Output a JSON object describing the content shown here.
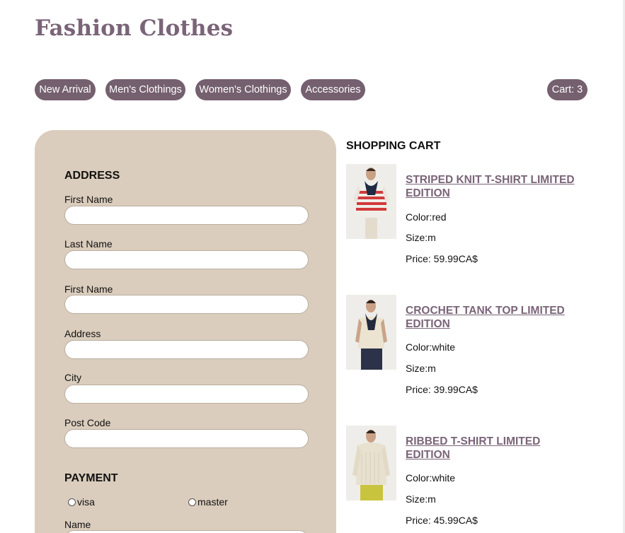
{
  "site": {
    "title": "Fashion Clothes"
  },
  "nav": {
    "items": [
      {
        "label": "New Arrival"
      },
      {
        "label": "Men's Clothings"
      },
      {
        "label": "Women's Clothings"
      },
      {
        "label": "Accessories"
      }
    ],
    "cart_label": "Cart: 3"
  },
  "form": {
    "address_heading": "ADDRESS",
    "fields": [
      {
        "label": "First Name",
        "value": ""
      },
      {
        "label": "Last Name",
        "value": ""
      },
      {
        "label": "First Name",
        "value": ""
      },
      {
        "label": "Address",
        "value": ""
      },
      {
        "label": "City",
        "value": ""
      },
      {
        "label": "Post Code",
        "value": ""
      }
    ],
    "payment_heading": "PAYMENT",
    "payment_options": [
      {
        "label": "visa",
        "selected": false
      },
      {
        "label": "master",
        "selected": false
      }
    ],
    "name_label": "Name",
    "name_value": ""
  },
  "cart": {
    "heading": "SHOPPING CART",
    "items": [
      {
        "name": "STRIPED KNIT T-SHIRT LIMITED EDITION",
        "color": "Color:red",
        "size": "Size:m",
        "price": "Price: 59.99CA$"
      },
      {
        "name": "CROCHET TANK TOP LIMITED EDITION",
        "color": "Color:white",
        "size": "Size:m",
        "price": "Price: 39.99CA$"
      },
      {
        "name": "RIBBED T-SHIRT LIMITED EDITION",
        "color": "Color:white",
        "size": "Size:m",
        "price": "Price: 45.99CA$"
      }
    ]
  },
  "colors": {
    "brand": "#7a6478",
    "nav_pill": "#75606f",
    "form_panel": "#dbcdbd"
  }
}
